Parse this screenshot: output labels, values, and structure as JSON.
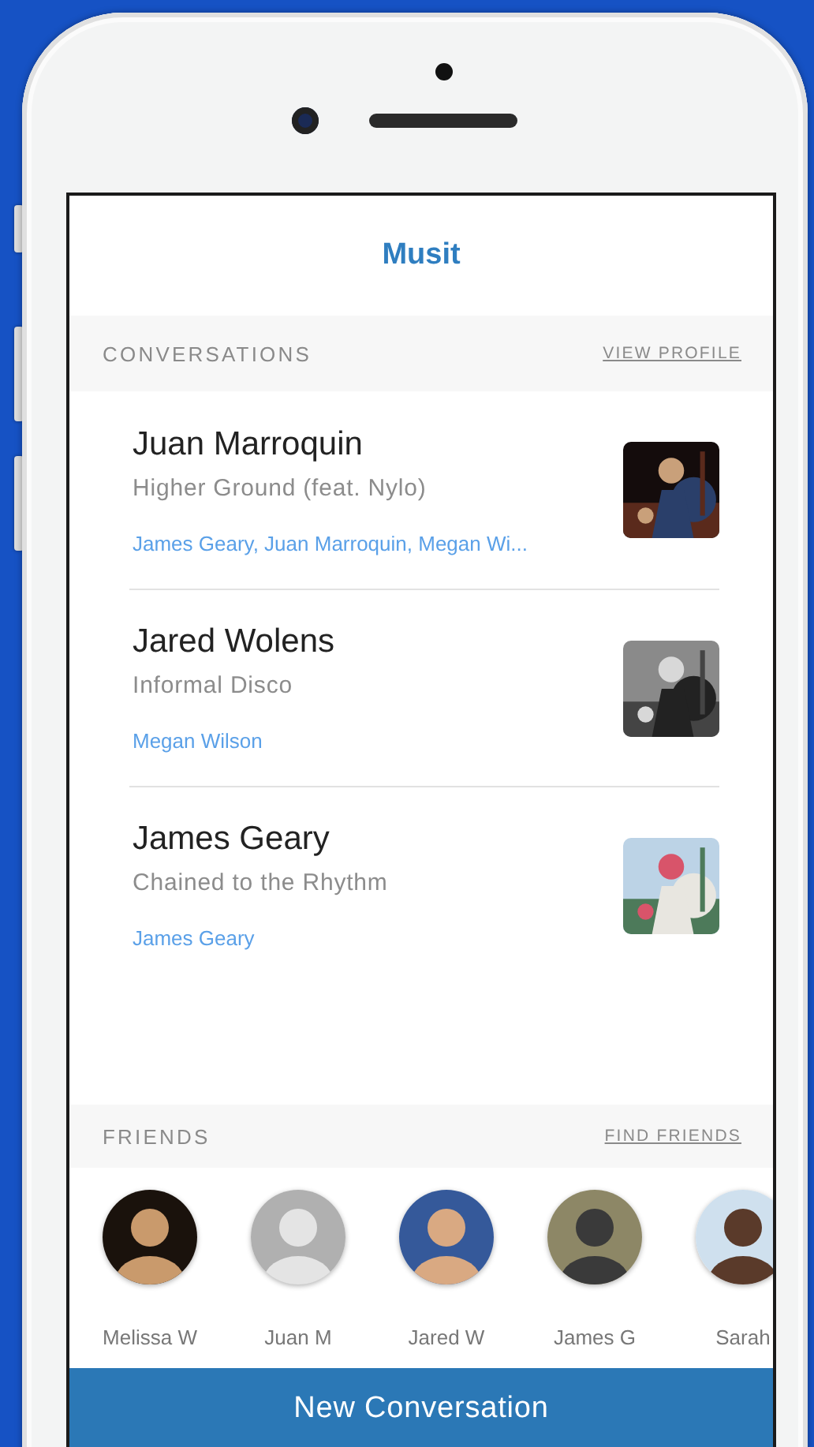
{
  "app": {
    "title": "Musit"
  },
  "conversations": {
    "heading": "CONVERSATIONS",
    "action": "VIEW PROFILE",
    "items": [
      {
        "name": "Juan Marroquin",
        "song": "Higher Ground (feat. Nylo)",
        "participants": "James Geary, Juan Marroquin, Megan Wi..."
      },
      {
        "name": "Jared Wolens",
        "song": "Informal Disco",
        "participants": "Megan Wilson"
      },
      {
        "name": "James Geary",
        "song": "Chained to the Rhythm",
        "participants": "James Geary"
      }
    ]
  },
  "friends": {
    "heading": "FRIENDS",
    "action": "FIND FRIENDS",
    "items": [
      {
        "name": "Melissa W"
      },
      {
        "name": "Juan M"
      },
      {
        "name": "Jared W"
      },
      {
        "name": "James G"
      },
      {
        "name": "Sarah"
      }
    ]
  },
  "new_conversation_button": "New Conversation"
}
